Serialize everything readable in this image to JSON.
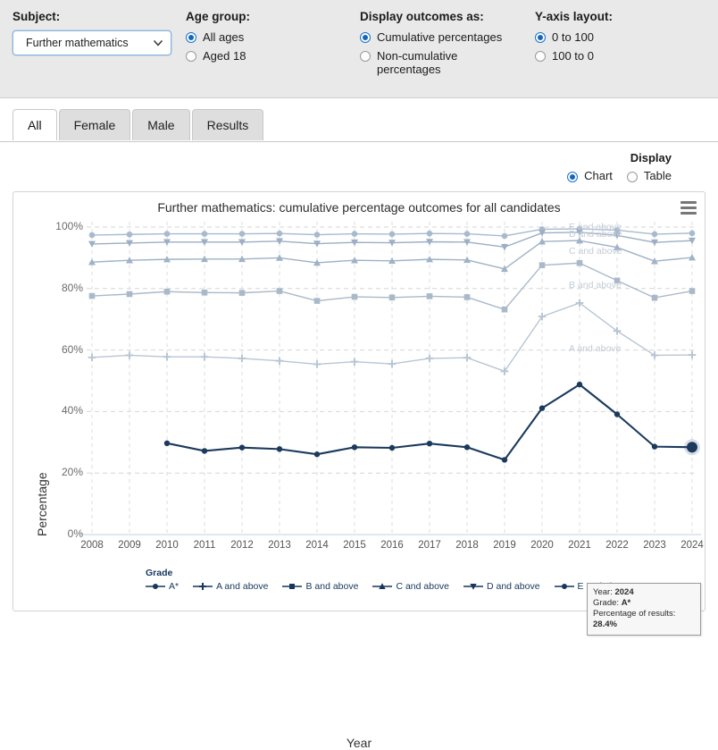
{
  "controls": {
    "subject": {
      "label": "Subject:",
      "value": "Further mathematics",
      "options": [
        "Further mathematics"
      ],
      "caret_icon": "chevron-down-icon"
    },
    "age_group": {
      "label": "Age group:",
      "options": [
        {
          "label": "All ages",
          "checked": true
        },
        {
          "label": "Aged 18",
          "checked": false
        }
      ]
    },
    "display_outcomes": {
      "label": "Display outcomes as:",
      "options": [
        {
          "label": "Cumulative percentages",
          "checked": true
        },
        {
          "label": "Non-cumulative percentages",
          "checked": false
        }
      ]
    },
    "y_axis_layout": {
      "label": "Y-axis layout:",
      "options": [
        {
          "label": "0 to 100",
          "checked": true
        },
        {
          "label": "100 to 0",
          "checked": false
        }
      ]
    }
  },
  "tabs": [
    {
      "label": "All",
      "active": true
    },
    {
      "label": "Female",
      "active": false
    },
    {
      "label": "Male",
      "active": false
    },
    {
      "label": "Results",
      "active": false
    }
  ],
  "display": {
    "title": "Display",
    "options": [
      {
        "label": "Chart",
        "checked": true
      },
      {
        "label": "Table",
        "checked": false
      }
    ]
  },
  "chart_menu": {
    "icon": "hamburger-menu-icon"
  },
  "tooltip": {
    "year_label": "Year:",
    "year_value": "2024",
    "grade_label": "Grade:",
    "grade_value": "A*",
    "pct_label": "Percentage of results:",
    "pct_value": "28.4%"
  },
  "astar_point_label": "A*",
  "chart_data": {
    "type": "line",
    "title": "Further mathematics: cumulative percentage outcomes for all candidates",
    "xlabel": "Year",
    "ylabel": "Percentage",
    "ylim": [
      0,
      100
    ],
    "ytick_labels": [
      "0%",
      "20%",
      "40%",
      "60%",
      "80%",
      "100%"
    ],
    "ytick_values": [
      0,
      20,
      40,
      60,
      80,
      100
    ],
    "grid": true,
    "legend_position": "bottom",
    "legend_title": "Grade",
    "categories": [
      2008,
      2009,
      2010,
      2011,
      2012,
      2013,
      2014,
      2015,
      2016,
      2017,
      2018,
      2019,
      2020,
      2021,
      2022,
      2023,
      2024
    ],
    "series": [
      {
        "name": "A*",
        "marker": "circle",
        "color": "#1b3a5c",
        "values": [
          null,
          null,
          29.7,
          27.2,
          28.3,
          27.8,
          26.1,
          28.4,
          28.2,
          29.6,
          28.4,
          24.3,
          41.1,
          48.8,
          39.1,
          28.6,
          28.4
        ]
      },
      {
        "name": "A and above",
        "marker": "plus",
        "color": "#b8c6d4",
        "values": [
          57.6,
          58.3,
          57.8,
          57.8,
          57.3,
          56.5,
          55.4,
          56.2,
          55.5,
          57.3,
          57.5,
          53.1,
          70.9,
          75.3,
          66.2,
          58.3,
          58.4
        ]
      },
      {
        "name": "B and above",
        "marker": "square",
        "color": "#aab9c9",
        "values": [
          77.6,
          78.2,
          79.0,
          78.7,
          78.6,
          79.2,
          76.0,
          77.3,
          77.1,
          77.5,
          77.2,
          73.2,
          87.6,
          88.3,
          82.6,
          77.0,
          79.2
        ]
      },
      {
        "name": "C and above",
        "marker": "triangle-up",
        "color": "#9fb2c6",
        "values": [
          88.6,
          89.2,
          89.5,
          89.6,
          89.6,
          90.0,
          88.4,
          89.2,
          89.0,
          89.5,
          89.3,
          86.4,
          95.3,
          95.6,
          93.4,
          88.9,
          90.1
        ]
      },
      {
        "name": "D and above",
        "marker": "triangle-down",
        "color": "#9cafc4",
        "values": [
          94.5,
          94.8,
          95.1,
          95.1,
          95.1,
          95.4,
          94.6,
          95.0,
          94.9,
          95.2,
          95.1,
          93.5,
          98.1,
          98.3,
          97.3,
          95.0,
          95.6
        ]
      },
      {
        "name": "E and above",
        "marker": "circle",
        "color": "#a8bacd",
        "values": [
          97.4,
          97.6,
          97.8,
          97.8,
          97.8,
          97.9,
          97.5,
          97.8,
          97.7,
          97.9,
          97.8,
          97.1,
          99.3,
          99.4,
          99.0,
          97.7,
          98.0
        ]
      }
    ],
    "end_labels": [
      "E and above",
      "D and above",
      "C and above",
      "B and above",
      "A and above"
    ],
    "highlight_point": {
      "series": "A*",
      "year": 2024,
      "value": 28.4
    }
  }
}
